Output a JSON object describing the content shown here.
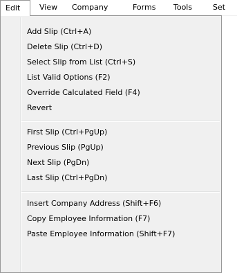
{
  "menubar": {
    "items": [
      {
        "label": "Edit"
      },
      {
        "label": "View"
      },
      {
        "label": "Company"
      },
      {
        "label": "Forms"
      },
      {
        "label": "Tools"
      },
      {
        "label": "Set"
      }
    ]
  },
  "edit_menu": {
    "items": [
      {
        "label": "Add Slip (Ctrl+A)"
      },
      {
        "label": "Delete Slip  (Ctrl+D)"
      },
      {
        "label": "Select Slip from List (Ctrl+S)"
      },
      {
        "label": "List Valid Options (F2)"
      },
      {
        "label": "Override Calculated Field (F4)"
      },
      {
        "label": "Revert"
      },
      {
        "label": "First Slip  (Ctrl+PgUp)"
      },
      {
        "label": "Previous Slip  (PgUp)"
      },
      {
        "label": "Next Slip  (PgDn)"
      },
      {
        "label": "Last Slip  (Ctrl+PgDn)"
      },
      {
        "label": "Insert Company Address (Shift+F6)"
      },
      {
        "label": "Copy Employee Information (F7)"
      },
      {
        "label": "Paste Employee Information (Shift+F7)"
      }
    ]
  }
}
